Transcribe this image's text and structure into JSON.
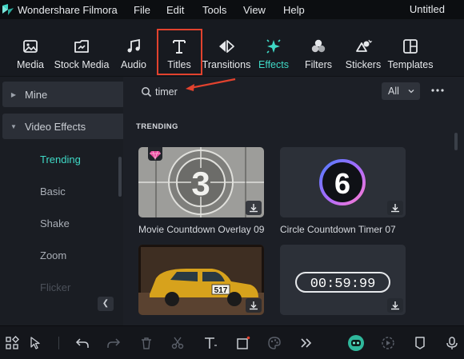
{
  "app": {
    "name": "Wondershare Filmora",
    "doc_title": "Untitled"
  },
  "menu": [
    "File",
    "Edit",
    "Tools",
    "View",
    "Help"
  ],
  "tabs": [
    {
      "label": "Media",
      "icon": "media-icon"
    },
    {
      "label": "Stock Media",
      "icon": "stock-media-icon"
    },
    {
      "label": "Audio",
      "icon": "audio-icon"
    },
    {
      "label": "Titles",
      "icon": "titles-icon"
    },
    {
      "label": "Transitions",
      "icon": "transitions-icon"
    },
    {
      "label": "Effects",
      "icon": "effects-icon",
      "active": true
    },
    {
      "label": "Filters",
      "icon": "filters-icon"
    },
    {
      "label": "Stickers",
      "icon": "stickers-icon"
    },
    {
      "label": "Templates",
      "icon": "templates-icon"
    }
  ],
  "sidebar": {
    "groups": [
      {
        "label": "Mine",
        "expanded": false
      },
      {
        "label": "Video Effects",
        "expanded": true
      }
    ],
    "items": [
      {
        "label": "Trending",
        "active": true
      },
      {
        "label": "Basic"
      },
      {
        "label": "Shake"
      },
      {
        "label": "Zoom"
      },
      {
        "label": "Flicker"
      }
    ]
  },
  "search": {
    "value": "timer",
    "placeholder": ""
  },
  "filter": {
    "value": "All"
  },
  "section": {
    "title": "TRENDING"
  },
  "effects": [
    {
      "name": "Movie Countdown Overlay 09",
      "digit": "3",
      "premium": true
    },
    {
      "name": "Circle Countdown Timer 07",
      "digit": "6"
    },
    {
      "name": "",
      "plate": "517"
    },
    {
      "name": "",
      "clock": "00:59:99"
    }
  ],
  "colors": {
    "accent": "#3fd9c6",
    "highlight": "#e2422e",
    "background": "#1c1f26"
  },
  "bottom_tools": [
    "layout-icon",
    "select-icon",
    "undo-icon",
    "redo-icon",
    "delete-icon",
    "cut-icon",
    "text-icon",
    "crop-icon",
    "color-icon",
    "more-icon",
    "ai-mate-icon",
    "render-icon",
    "marker-icon",
    "mic-icon"
  ]
}
